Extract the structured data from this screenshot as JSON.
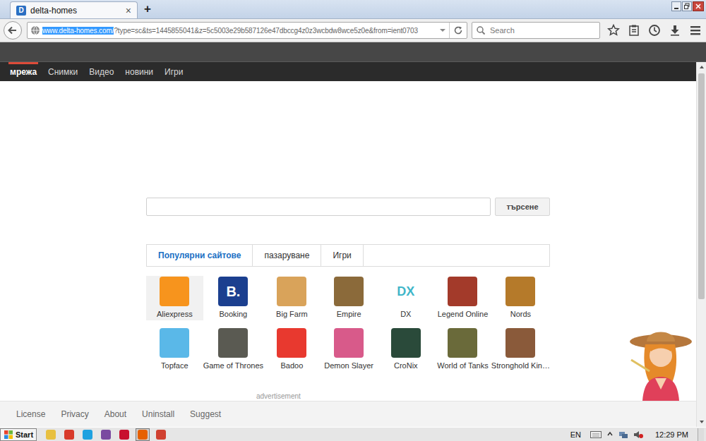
{
  "browser": {
    "tabs": [
      {
        "label": "delta-homes",
        "favicon": "D",
        "close": "×",
        "selected": true
      }
    ],
    "new_tab": "+",
    "url": {
      "highlighted": "www.delta-homes.com/",
      "rest": "?type=sc&ts=1445855041&z=5c5003e29b587126e47dbccg4z0z3wcbdw8wce5z0e&from=ient0703"
    },
    "search": {
      "placeholder": "Search"
    }
  },
  "page": {
    "nav": [
      {
        "label": "мрежа",
        "selected": true
      },
      {
        "label": "Снимки",
        "selected": false
      },
      {
        "label": "Видео",
        "selected": false
      },
      {
        "label": "новини",
        "selected": false
      },
      {
        "label": "Игри",
        "selected": false
      }
    ],
    "search_button": "търсене",
    "category_tabs": [
      {
        "label": "Популярни сайтове",
        "selected": true
      },
      {
        "label": "пазаруване",
        "selected": false
      },
      {
        "label": "Игри",
        "selected": false
      }
    ],
    "sites": [
      {
        "label": "Aliexpress",
        "color": "#f7941d",
        "highlighted": true
      },
      {
        "label": "Booking",
        "color": "#1b3f8f",
        "glyph": "B.",
        "highlighted": false
      },
      {
        "label": "Big Farm",
        "color": "#d9a35a",
        "highlighted": false
      },
      {
        "label": "Empire",
        "color": "#8b6a3a",
        "highlighted": false
      },
      {
        "label": "DX",
        "color": "#ffffff",
        "glyph": "DX",
        "highlighted": false
      },
      {
        "label": "Legend Online",
        "color": "#a33a2a",
        "highlighted": false
      },
      {
        "label": "Nords",
        "color": "#b57a2a",
        "highlighted": false
      },
      {
        "label": "Topface",
        "color": "#5ab8e8",
        "highlighted": false
      },
      {
        "label": "Game of Thrones",
        "color": "#5a5a52",
        "highlighted": false
      },
      {
        "label": "Badoo",
        "color": "#e8392f",
        "highlighted": false
      },
      {
        "label": "Demon Slayer",
        "color": "#d85a8a",
        "highlighted": false
      },
      {
        "label": "CroNix",
        "color": "#2a4a3a",
        "highlighted": false
      },
      {
        "label": "World of Tanks",
        "color": "#6a6a3a",
        "highlighted": false
      },
      {
        "label": "Stronghold Kin…",
        "color": "#8a5a3a",
        "highlighted": false
      }
    ],
    "ad_label": "advertisement",
    "footer_links": [
      "License",
      "Privacy",
      "About",
      "Uninstall",
      "Suggest"
    ]
  },
  "taskbar": {
    "start": "Start",
    "apps": [
      {
        "color": "#e8c040",
        "selected": false
      },
      {
        "color": "#d83a2a",
        "selected": false
      },
      {
        "color": "#1da1e0",
        "selected": false
      },
      {
        "color": "#7a4aa0",
        "selected": false
      },
      {
        "color": "#c8102e",
        "selected": false
      },
      {
        "color": "#e66000",
        "selected": true
      },
      {
        "color": "#d04030",
        "selected": false
      }
    ],
    "language": "EN",
    "clock": "12:29 PM"
  }
}
